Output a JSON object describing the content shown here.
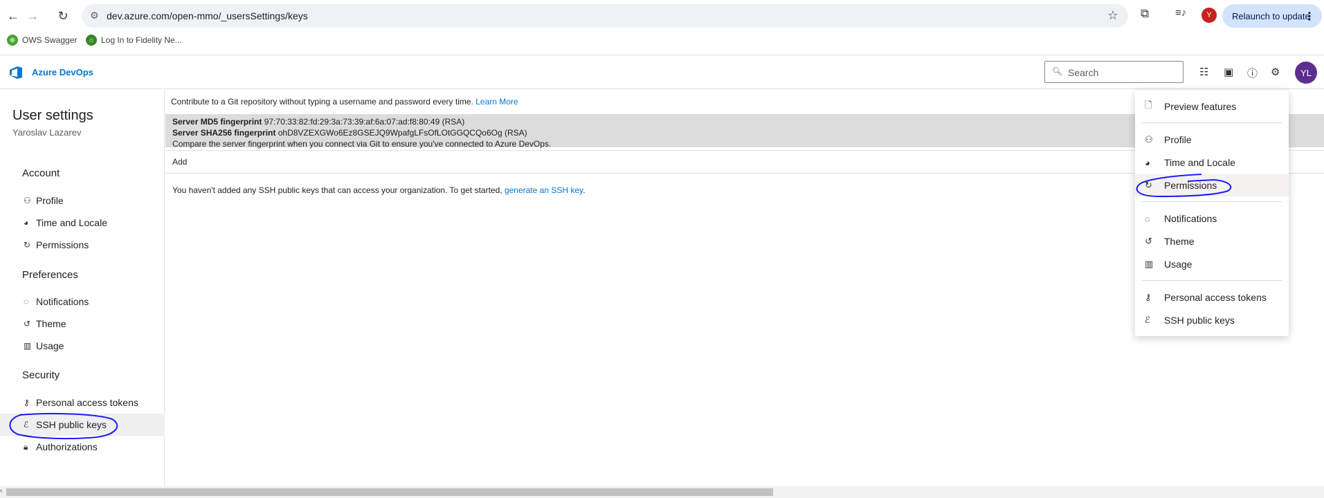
{
  "browser": {
    "url": "dev.azure.com/open-mmo/_usersSettings/keys",
    "relaunch_label": "Relaunch to update",
    "profile_initial": "Y",
    "bookmarks": [
      {
        "label": "OWS Swagger",
        "icon": "swagger-icon",
        "color": "#49a32b"
      },
      {
        "label": "Log In to Fidelity Ne...",
        "icon": "fidelity-icon",
        "color": "#368727"
      }
    ]
  },
  "header": {
    "product": "Azure DevOps",
    "search_placeholder": "Search",
    "avatar_initials": "YL",
    "brand_color": "#0078d4",
    "avatar_color": "#5c2e91"
  },
  "sidebar": {
    "title": "User settings",
    "user_name": "Yaroslav Lazarev",
    "sections": [
      {
        "heading": "Account",
        "items": [
          {
            "label": "Profile",
            "icon": "profile-icon"
          },
          {
            "label": "Time and Locale",
            "icon": "globe-icon"
          },
          {
            "label": "Permissions",
            "icon": "refresh-icon"
          }
        ]
      },
      {
        "heading": "Preferences",
        "items": [
          {
            "label": "Notifications",
            "icon": "chat-icon"
          },
          {
            "label": "Theme",
            "icon": "theme-icon"
          },
          {
            "label": "Usage",
            "icon": "chart-icon"
          }
        ]
      },
      {
        "heading": "Security",
        "items": [
          {
            "label": "Personal access tokens",
            "icon": "key-icon"
          },
          {
            "label": "SSH public keys",
            "icon": "fingerprint-icon",
            "active": true
          },
          {
            "label": "Authorizations",
            "icon": "lock-icon"
          }
        ]
      }
    ]
  },
  "main": {
    "intro_text": "Contribute to a Git repository without typing a username and password every time.",
    "learn_more": "Learn More",
    "md5_label": "Server MD5 fingerprint",
    "md5_value": "97:70:33:82:fd:29:3a:73:39:af:6a:07:ad:f8:80:49 (RSA)",
    "sha_label": "Server SHA256 fingerprint",
    "sha_value": "ohD8VZEXGWo6Ez8GSEJQ9WpafgLFsOfLOtGGQCQo6Og (RSA)",
    "compare_note": "Compare the server fingerprint when you connect via Git to ensure you've connected to Azure DevOps.",
    "add_label": "Add",
    "empty_text": "You haven't added any SSH public keys that can access your organization. To get started,",
    "empty_link": "generate an SSH key",
    "empty_end": "."
  },
  "menu": {
    "items": [
      {
        "label": "Preview features",
        "icon": "page-icon"
      },
      {
        "label": "Profile",
        "icon": "profile-icon"
      },
      {
        "label": "Time and Locale",
        "icon": "globe-icon"
      },
      {
        "label": "Permissions",
        "icon": "refresh-icon",
        "highlighted": true
      },
      {
        "label": "Notifications",
        "icon": "chat-icon"
      },
      {
        "label": "Theme",
        "icon": "theme-icon"
      },
      {
        "label": "Usage",
        "icon": "chart-icon"
      },
      {
        "label": "Personal access tokens",
        "icon": "key-icon"
      },
      {
        "label": "SSH public keys",
        "icon": "fingerprint-icon"
      }
    ]
  },
  "annotation_color": "#1a1aff"
}
